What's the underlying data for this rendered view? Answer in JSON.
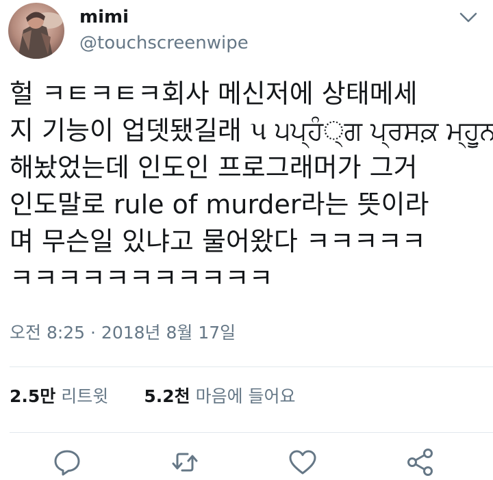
{
  "author": {
    "display_name": "mimi",
    "handle": "@touchscreenwipe"
  },
  "tweet": {
    "lines": [
      "헐 ㅋㅌㅋㅌㅋ회사 메신저에 상태메세",
      "지 기능이 업뎃됐길래 ૫ ੫ਪ੍ਹੰ੍ਗ ਪ੍ਰਸਕ਼ ਮ੍ਹੂ਼ਨ",
      "해놨었는데 인도인 프로그래머가 그거",
      "인도말로 rule of murder라는 뜻이라",
      "며 무슨일 있냐고 물어왔다 ㅋㅋㅋㅋㅋ",
      "ㅋㅋㅋㅋㅋㅋㅋㅋㅋㅋㅋ"
    ],
    "timestamp": "오전 8:25 · 2018년 8월 17일"
  },
  "stats": {
    "retweets_count": "2.5만",
    "retweets_label": "리트윗",
    "likes_count": "5.2천",
    "likes_label": "마음에 들어요"
  },
  "icons": {
    "caret": "chevron-down-icon",
    "reply": "reply-icon",
    "retweet": "retweet-icon",
    "like": "heart-icon",
    "share": "share-icon"
  },
  "colors": {
    "text": "#14171a",
    "secondary": "#657786",
    "divider": "#e1e8ed"
  }
}
